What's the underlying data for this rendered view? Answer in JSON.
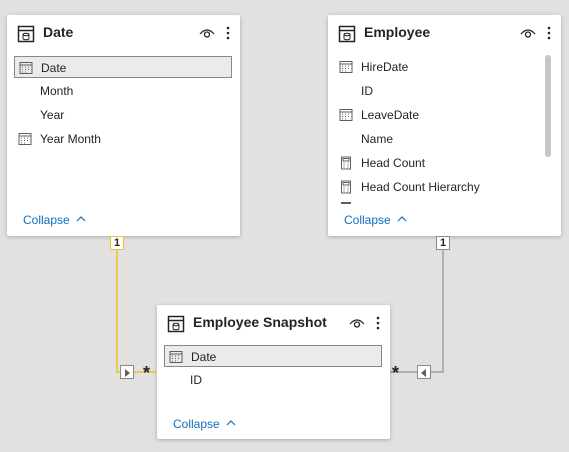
{
  "tables": {
    "date": {
      "title": "Date",
      "fields": [
        {
          "label": "Date",
          "icon": "calendar-icon"
        },
        {
          "label": "Month",
          "icon": ""
        },
        {
          "label": "Year",
          "icon": ""
        },
        {
          "label": "Year Month",
          "icon": "calendar-icon"
        }
      ],
      "collapse_label": "Collapse"
    },
    "employee": {
      "title": "Employee",
      "fields": [
        {
          "label": "HireDate",
          "icon": "calendar-icon"
        },
        {
          "label": "ID",
          "icon": ""
        },
        {
          "label": "LeaveDate",
          "icon": "calendar-icon"
        },
        {
          "label": "Name",
          "icon": ""
        },
        {
          "label": "Head Count",
          "icon": "calculator-icon"
        },
        {
          "label": "Head Count Hierarchy",
          "icon": "calculator-icon"
        }
      ],
      "collapse_label": "Collapse"
    },
    "employee_snapshot": {
      "title": "Employee Snapshot",
      "fields": [
        {
          "label": "Date",
          "icon": "calendar-icon"
        },
        {
          "label": "ID",
          "icon": ""
        }
      ],
      "collapse_label": "Collapse"
    }
  },
  "relationships": {
    "date_to_snapshot": {
      "from_cardinality": "1",
      "to_cardinality": "*",
      "color": "#e8c22f"
    },
    "employee_to_snapshot": {
      "from_cardinality": "1",
      "to_cardinality": "*",
      "color": "#8a8886"
    }
  },
  "colors": {
    "link": "#106ebe",
    "canvas": "#e3e1df"
  }
}
